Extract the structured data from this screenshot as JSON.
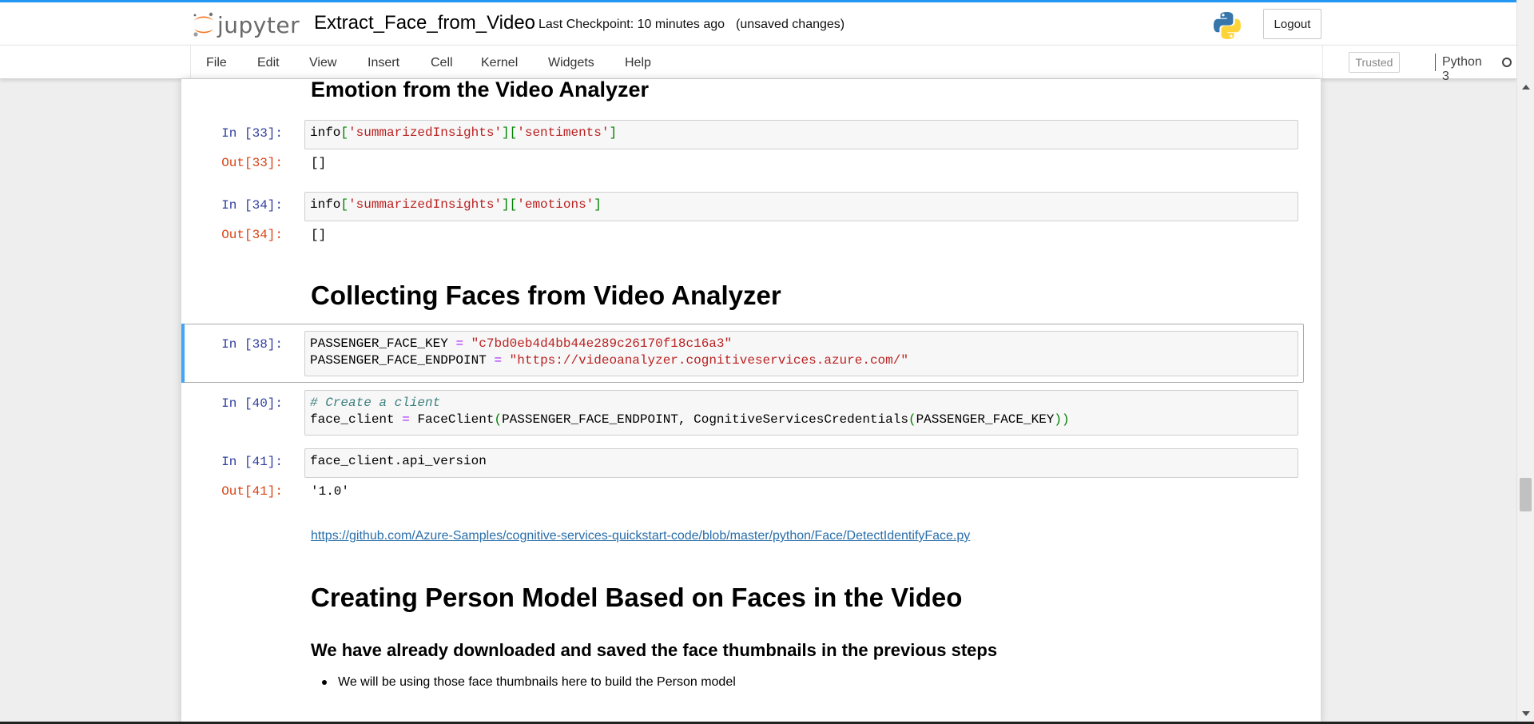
{
  "header": {
    "logo_text": "jupyter",
    "notebook_title": "Extract_Face_from_Video",
    "checkpoint": "Last Checkpoint: 10 minutes ago",
    "unsaved": "(unsaved changes)",
    "logout_label": "Logout",
    "brand_color": "#F37726",
    "accent_color": "#2196F3"
  },
  "menubar": {
    "items": [
      "File",
      "Edit",
      "View",
      "Insert",
      "Cell",
      "Kernel",
      "Widgets",
      "Help"
    ],
    "trusted_label": "Trusted",
    "kernel_name": "Python 3"
  },
  "notebook": {
    "heading_emotion": "Emotion from the Video Analyzer",
    "cell33": {
      "in_prompt": "In [33]:",
      "code": {
        "obj": "info",
        "key1": "'summarizedInsights'",
        "key2": "'sentiments'"
      },
      "out_prompt": "Out[33]:",
      "output": "[]"
    },
    "cell34": {
      "in_prompt": "In [34]:",
      "code": {
        "obj": "info",
        "key1": "'summarizedInsights'",
        "key2": "'emotions'"
      },
      "out_prompt": "Out[34]:",
      "output": "[]"
    },
    "heading_collecting": "Collecting Faces from Video Analyzer",
    "cell38": {
      "in_prompt": "In [38]:",
      "line1_name": "PASSENGER_FACE_KEY",
      "line1_value": "\"c7bd0eb4d4bb44e289c26170f18c16a3\"",
      "line2_name": "PASSENGER_FACE_ENDPOINT",
      "line2_value": "\"https://videoanalyzer.cognitiveservices.azure.com/\""
    },
    "cell40": {
      "in_prompt": "In [40]:",
      "comment": "# Create a client",
      "var": "face_client",
      "func": "FaceClient",
      "arg1": "PASSENGER_FACE_ENDPOINT",
      "creds": "CognitiveServicesCredentials",
      "arg2": "PASSENGER_FACE_KEY"
    },
    "cell41": {
      "in_prompt": "In [41]:",
      "code": "face_client.api_version",
      "out_prompt": "Out[41]:",
      "output": "'1.0'"
    },
    "link": "https://github.com/Azure-Samples/cognitive-services-quickstart-code/blob/master/python/Face/DetectIdentifyFace.py",
    "heading_person": "Creating Person Model Based on Faces in the Video",
    "subheading": "We have already downloaded and saved the face thumbnails in the previous steps",
    "bullet": "We will be using those face thumbnails here to build the Person model"
  }
}
